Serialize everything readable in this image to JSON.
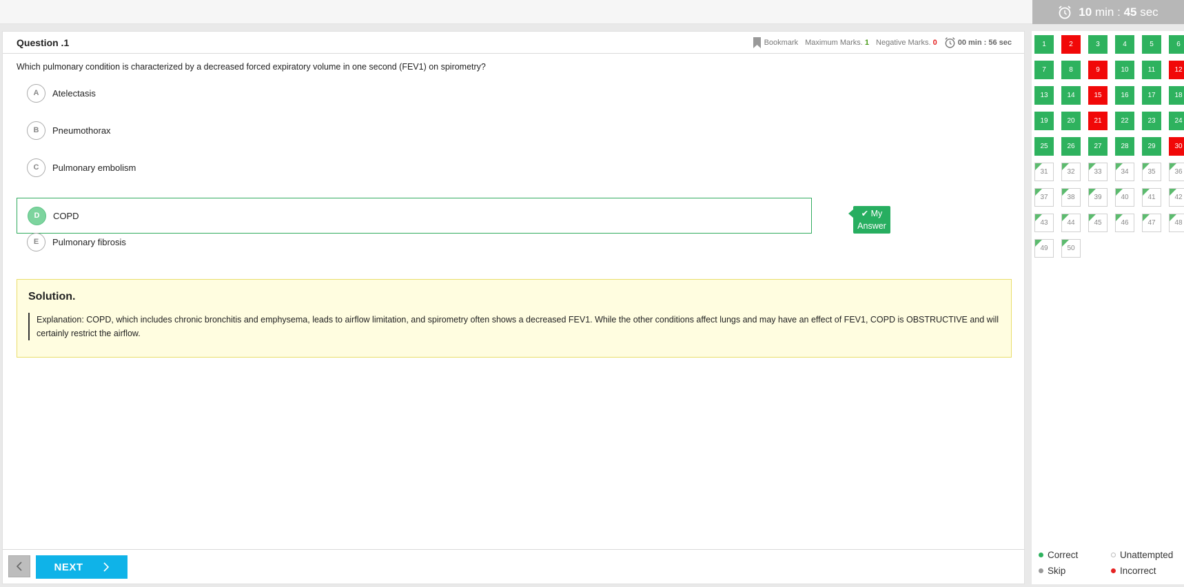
{
  "header": {
    "timer": {
      "min": "10",
      "min_unit": "min",
      "sec": "45",
      "sec_unit": "sec"
    }
  },
  "question": {
    "title": "Question .1",
    "bookmark_label": "Bookmark",
    "max_marks_label": "Maximum Marks.",
    "max_marks_value": "1",
    "negative_marks_label": "Negative Marks.",
    "negative_marks_value": "0",
    "timer": "00 min : 56 sec",
    "text": "Which pulmonary condition is characterized by a decreased forced expiratory volume in one second (FEV1) on spirometry?",
    "options": [
      {
        "letter": "A",
        "text": "Atelectasis"
      },
      {
        "letter": "B",
        "text": "Pneumothorax"
      },
      {
        "letter": "C",
        "text": "Pulmonary embolism"
      },
      {
        "letter": "D",
        "text": "COPD"
      },
      {
        "letter": "E",
        "text": "Pulmonary fibrosis"
      }
    ],
    "selected_option": "D",
    "my_answer_label_1": "My",
    "my_answer_label_2": "Answer"
  },
  "solution": {
    "title": "Solution.",
    "body": "Explanation: COPD, which includes chronic bronchitis and emphysema, leads to airflow limitation, and spirometry often shows a decreased FEV1. While the other conditions affect lungs and may have an effect of FEV1, COPD is OBSTRUCTIVE and will certainly restrict the airflow."
  },
  "footer": {
    "prev_icon": "chevron-left-icon",
    "next_label": "NEXT"
  },
  "palette": {
    "items": [
      {
        "n": "1",
        "s": "correct"
      },
      {
        "n": "2",
        "s": "incorrect"
      },
      {
        "n": "3",
        "s": "correct"
      },
      {
        "n": "4",
        "s": "correct"
      },
      {
        "n": "5",
        "s": "correct"
      },
      {
        "n": "6",
        "s": "correct"
      },
      {
        "n": "7",
        "s": "correct"
      },
      {
        "n": "8",
        "s": "correct"
      },
      {
        "n": "9",
        "s": "incorrect"
      },
      {
        "n": "10",
        "s": "correct"
      },
      {
        "n": "11",
        "s": "correct"
      },
      {
        "n": "12",
        "s": "incorrect"
      },
      {
        "n": "13",
        "s": "correct"
      },
      {
        "n": "14",
        "s": "correct"
      },
      {
        "n": "15",
        "s": "incorrect"
      },
      {
        "n": "16",
        "s": "correct"
      },
      {
        "n": "17",
        "s": "correct"
      },
      {
        "n": "18",
        "s": "correct"
      },
      {
        "n": "19",
        "s": "correct"
      },
      {
        "n": "20",
        "s": "correct"
      },
      {
        "n": "21",
        "s": "incorrect"
      },
      {
        "n": "22",
        "s": "correct"
      },
      {
        "n": "23",
        "s": "correct"
      },
      {
        "n": "24",
        "s": "correct"
      },
      {
        "n": "25",
        "s": "correct"
      },
      {
        "n": "26",
        "s": "correct"
      },
      {
        "n": "27",
        "s": "correct"
      },
      {
        "n": "28",
        "s": "correct"
      },
      {
        "n": "29",
        "s": "correct"
      },
      {
        "n": "30",
        "s": "incorrect"
      },
      {
        "n": "31",
        "s": "unattempted"
      },
      {
        "n": "32",
        "s": "unattempted"
      },
      {
        "n": "33",
        "s": "unattempted"
      },
      {
        "n": "34",
        "s": "unattempted"
      },
      {
        "n": "35",
        "s": "unattempted"
      },
      {
        "n": "36",
        "s": "unattempted"
      },
      {
        "n": "37",
        "s": "unattempted"
      },
      {
        "n": "38",
        "s": "unattempted"
      },
      {
        "n": "39",
        "s": "unattempted"
      },
      {
        "n": "40",
        "s": "unattempted"
      },
      {
        "n": "41",
        "s": "unattempted"
      },
      {
        "n": "42",
        "s": "unattempted"
      },
      {
        "n": "43",
        "s": "unattempted"
      },
      {
        "n": "44",
        "s": "unattempted"
      },
      {
        "n": "45",
        "s": "unattempted"
      },
      {
        "n": "46",
        "s": "unattempted"
      },
      {
        "n": "47",
        "s": "unattempted"
      },
      {
        "n": "48",
        "s": "unattempted"
      },
      {
        "n": "49",
        "s": "unattempted"
      },
      {
        "n": "50",
        "s": "unattempted"
      }
    ],
    "legend": {
      "correct": "Correct",
      "unattempted": "Unattempted",
      "skip": "Skip",
      "incorrect": "Incorrect"
    }
  },
  "colors": {
    "correct": "#2eb25e",
    "incorrect": "#f10808",
    "next_button": "#0fb3e8",
    "solution_bg": "#fffde0"
  }
}
